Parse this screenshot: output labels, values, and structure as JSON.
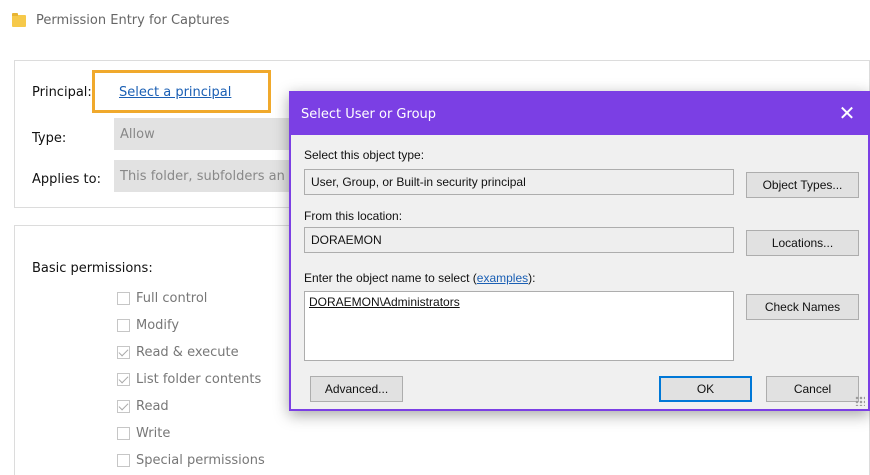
{
  "window": {
    "title": "Permission Entry for Captures"
  },
  "entry": {
    "principal_label": "Principal:",
    "principal_link": "Select a principal",
    "type_label": "Type:",
    "type_value": "Allow",
    "applies_label": "Applies to:",
    "applies_value": "This folder, subfolders an"
  },
  "permissions": {
    "title": "Basic permissions:",
    "items": [
      {
        "label": "Full control",
        "checked": false
      },
      {
        "label": "Modify",
        "checked": false
      },
      {
        "label": "Read & execute",
        "checked": true
      },
      {
        "label": "List folder contents",
        "checked": true
      },
      {
        "label": "Read",
        "checked": true
      },
      {
        "label": "Write",
        "checked": false
      },
      {
        "label": "Special permissions",
        "checked": false
      }
    ]
  },
  "dialog": {
    "title": "Select User or Group",
    "close_icon": "close-icon",
    "object_type_label": "Select this object type:",
    "object_type_value": "User, Group, or Built-in security principal",
    "object_types_button": "Object Types...",
    "location_label": "From this location:",
    "location_value": "DORAEMON",
    "locations_button": "Locations...",
    "object_name_label_prefix": "Enter the object name to select (",
    "object_name_label_link": "examples",
    "object_name_label_suffix": "):",
    "object_name_value": "DORAEMON\\Administrators",
    "check_names_button": "Check Names",
    "advanced_button": "Advanced...",
    "ok_button": "OK",
    "cancel_button": "Cancel"
  },
  "colors": {
    "dialog_accent": "#7b3fe4",
    "highlight": "#f0a92c",
    "link": "#1a5fb4"
  }
}
